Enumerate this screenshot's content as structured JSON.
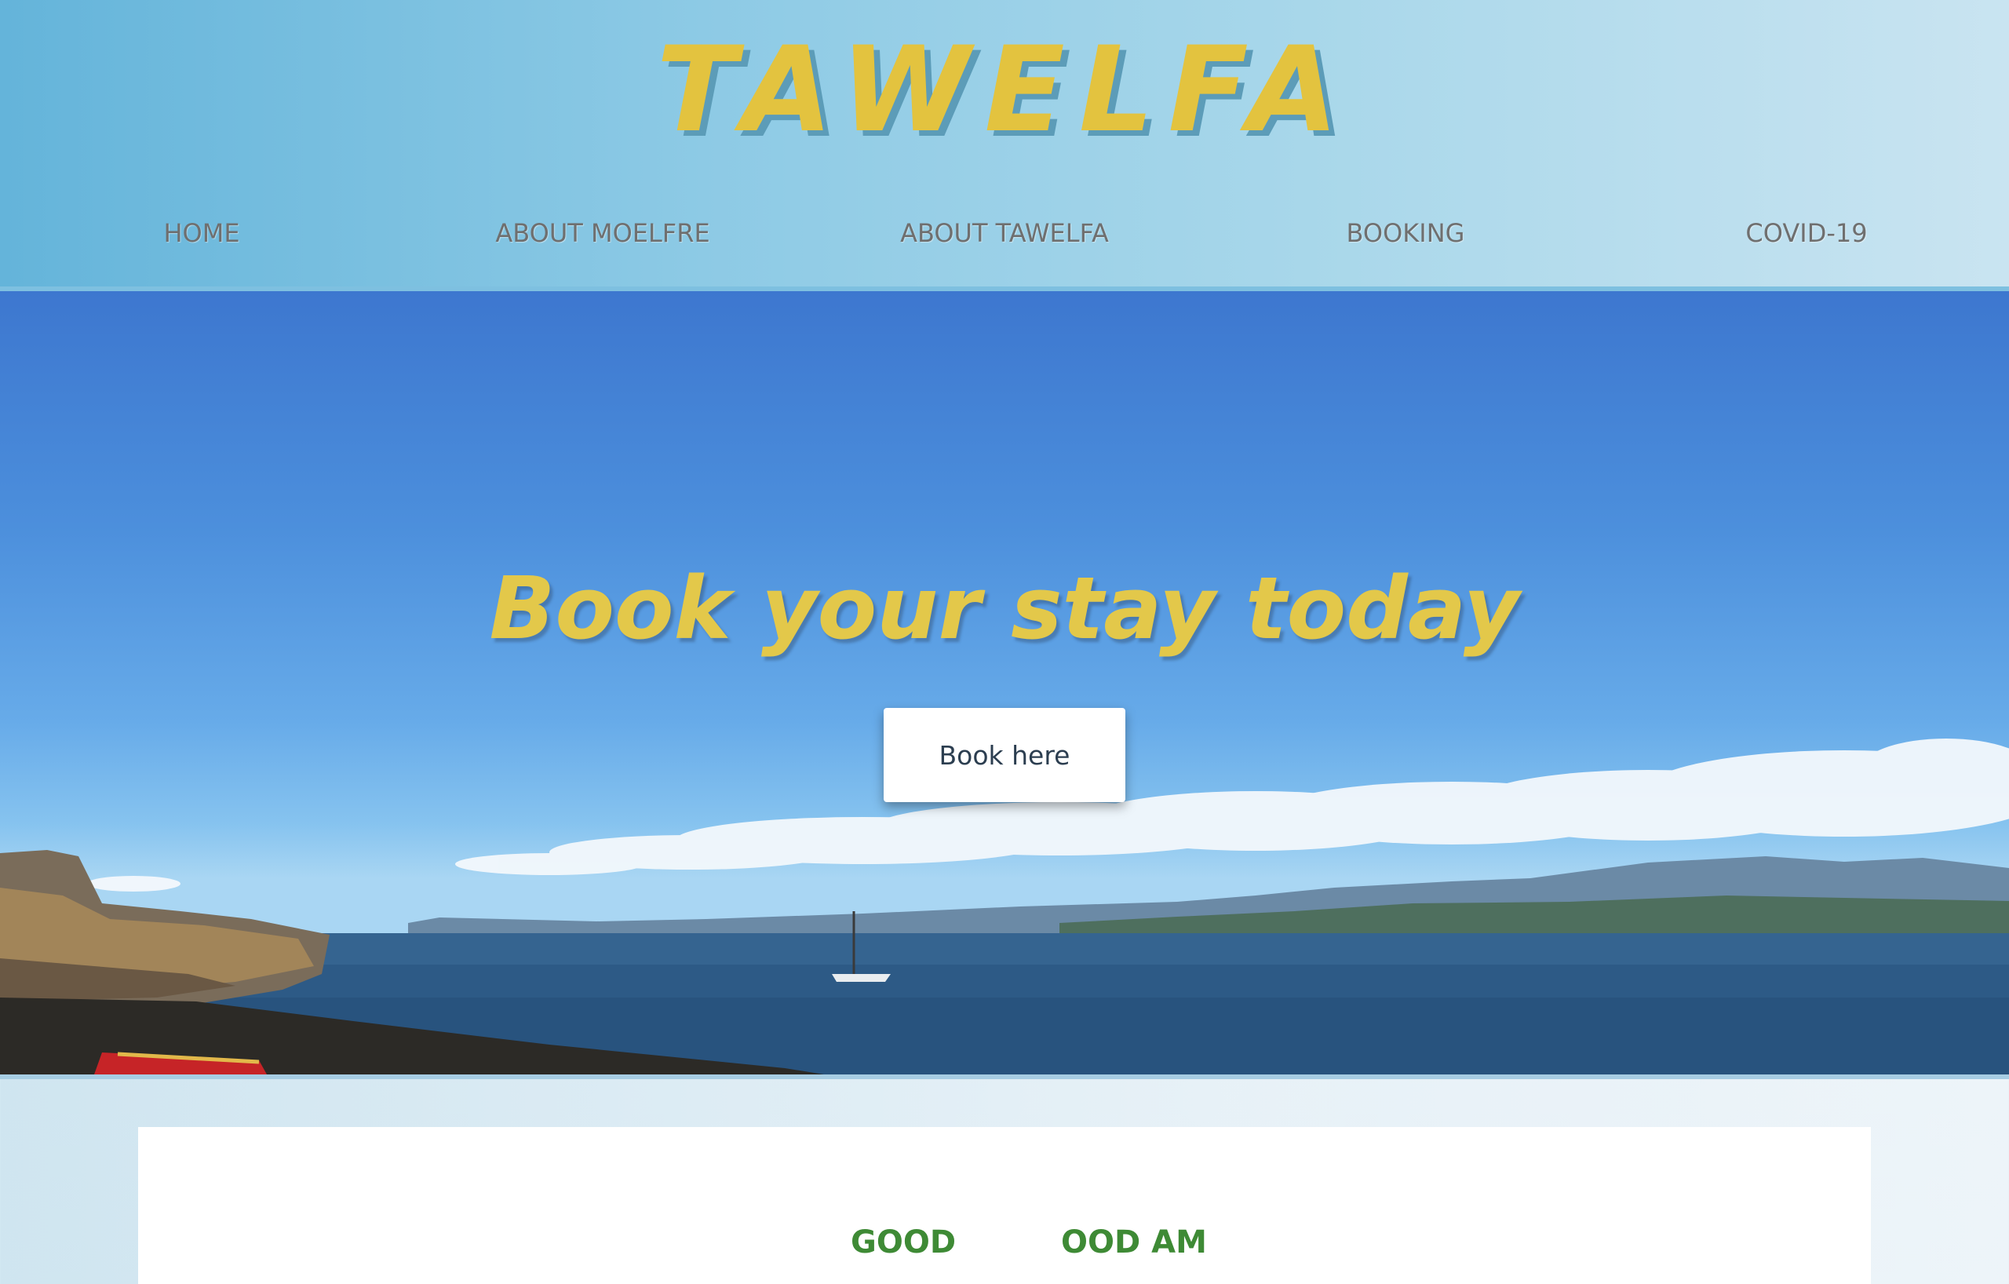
{
  "site": {
    "logo": "TAWELFA"
  },
  "nav": {
    "items": [
      {
        "label": "HOME"
      },
      {
        "label": "ABOUT MOELFRE"
      },
      {
        "label": "ABOUT TAWELFA"
      },
      {
        "label": "BOOKING"
      },
      {
        "label": "COVID-19"
      }
    ]
  },
  "hero": {
    "title": "Book your stay today",
    "button_label": "Book here"
  },
  "card": {
    "badge_left": "GOOD",
    "badge_right": "OOD AM"
  },
  "colors": {
    "accent_yellow": "#e3c33f",
    "header_blue": "#64b4da",
    "nav_text": "#6f6f6f",
    "badge_green": "#3e8a35"
  }
}
